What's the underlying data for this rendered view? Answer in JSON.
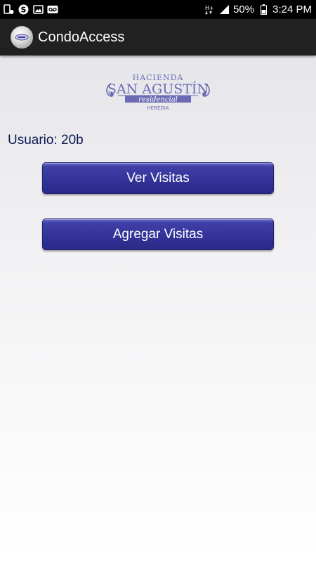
{
  "status_bar": {
    "icons_left": [
      "notification-icon",
      "skype-icon",
      "gallery-icon",
      "voicemail-icon"
    ],
    "battery_percent": "50%",
    "time": "3:24 PM",
    "icons_right": [
      "signal-icon",
      "battery-icon"
    ]
  },
  "action_bar": {
    "title": "CondoAccess"
  },
  "logo": {
    "line1": "HACIENDA",
    "line2": "SAN AGUSTÍN",
    "line3": "residencial",
    "line4": "HEREDIA"
  },
  "user": {
    "label": "Usuario: 20b"
  },
  "buttons": {
    "view": "Ver Visitas",
    "add": "Agregar Visitas"
  },
  "colors": {
    "button_fill": "#33339a",
    "text_navy": "#0c1452",
    "logo_purple": "#6b6bb5"
  }
}
